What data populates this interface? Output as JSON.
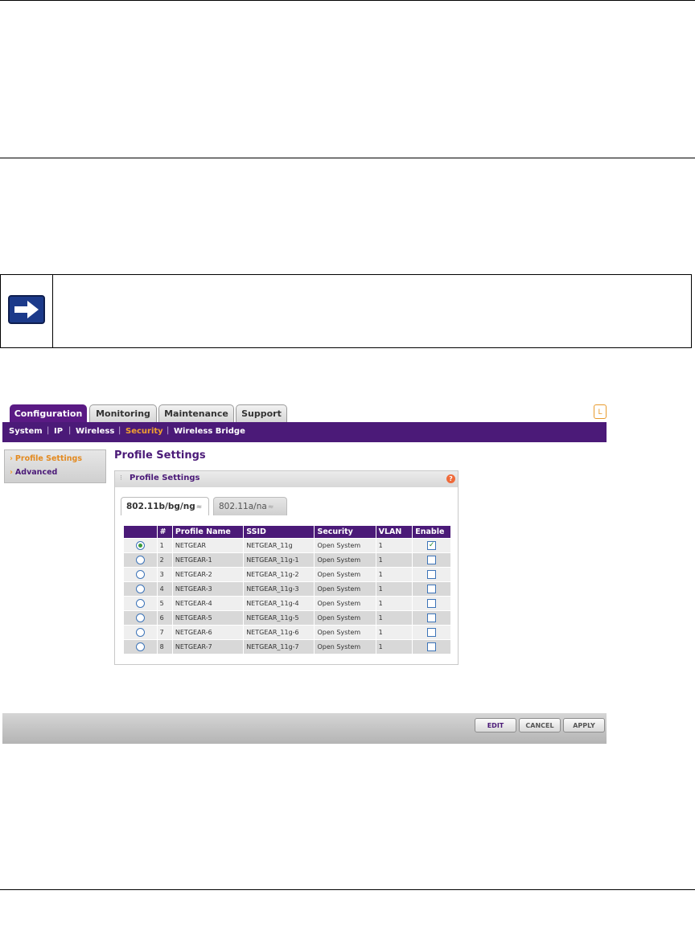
{
  "app": {
    "main_tabs": [
      {
        "label": "Configuration",
        "active": true
      },
      {
        "label": "Monitoring",
        "active": false
      },
      {
        "label": "Maintenance",
        "active": false
      },
      {
        "label": "Support",
        "active": false
      }
    ],
    "top_right_label": "L",
    "subnav": [
      {
        "label": "System"
      },
      {
        "label": "IP"
      },
      {
        "label": "Wireless"
      },
      {
        "label": "Security",
        "active": true
      },
      {
        "label": "Wireless Bridge"
      }
    ],
    "subnav_sep": "|",
    "sidebar": [
      {
        "label": "Profile Settings",
        "active": true
      },
      {
        "label": "Advanced",
        "active": false
      }
    ],
    "sidebar_arrow": "›",
    "page_title": "Profile Settings",
    "panel_title": "Profile Settings",
    "help_icon": "?",
    "band_tabs": [
      {
        "label": "802.11b/bg/ng",
        "active": true
      },
      {
        "label": "802.11a/na",
        "active": false
      }
    ],
    "table": {
      "headers": [
        "",
        "#",
        "Profile Name",
        "SSID",
        "Security",
        "VLAN",
        "Enable"
      ],
      "rows": [
        {
          "num": "1",
          "name": "NETGEAR",
          "ssid": "NETGEAR_11g",
          "security": "Open System",
          "vlan": "1",
          "selected": true,
          "enabled": true
        },
        {
          "num": "2",
          "name": "NETGEAR-1",
          "ssid": "NETGEAR_11g-1",
          "security": "Open System",
          "vlan": "1",
          "selected": false,
          "enabled": false
        },
        {
          "num": "3",
          "name": "NETGEAR-2",
          "ssid": "NETGEAR_11g-2",
          "security": "Open System",
          "vlan": "1",
          "selected": false,
          "enabled": false
        },
        {
          "num": "4",
          "name": "NETGEAR-3",
          "ssid": "NETGEAR_11g-3",
          "security": "Open System",
          "vlan": "1",
          "selected": false,
          "enabled": false
        },
        {
          "num": "5",
          "name": "NETGEAR-4",
          "ssid": "NETGEAR_11g-4",
          "security": "Open System",
          "vlan": "1",
          "selected": false,
          "enabled": false
        },
        {
          "num": "6",
          "name": "NETGEAR-5",
          "ssid": "NETGEAR_11g-5",
          "security": "Open System",
          "vlan": "1",
          "selected": false,
          "enabled": false
        },
        {
          "num": "7",
          "name": "NETGEAR-6",
          "ssid": "NETGEAR_11g-6",
          "security": "Open System",
          "vlan": "1",
          "selected": false,
          "enabled": false
        },
        {
          "num": "8",
          "name": "NETGEAR-7",
          "ssid": "NETGEAR_11g-7",
          "security": "Open System",
          "vlan": "1",
          "selected": false,
          "enabled": false
        }
      ]
    },
    "buttons": {
      "edit": "EDIT",
      "cancel": "CANCEL",
      "apply": "APPLY"
    },
    "colors": {
      "brand_purple": "#4b1a78",
      "accent_orange": "#f0a030"
    }
  }
}
